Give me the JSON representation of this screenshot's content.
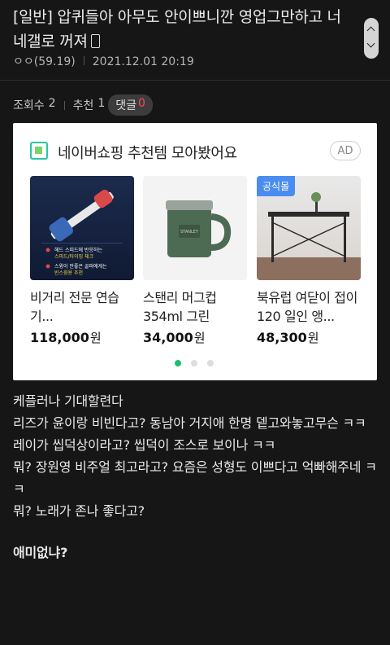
{
  "post": {
    "title": "[일반] 압퀴들아 아무도 안이쁘니깐 영업그만하고 너네갤로 꺼져",
    "author": "ㅇㅇ(59.19)",
    "datetime": "2021.12.01 20:19",
    "views_label": "조회수",
    "views": "2",
    "recommend_label": "추천",
    "recommend": "1",
    "comments_label": "댓글",
    "comments": "0"
  },
  "ad": {
    "header": "네이버쇼핑 추천템 모아봤어요",
    "badge": "AD",
    "official_badge": "공식몰",
    "products": [
      {
        "name": "비거리 전문 연습기...",
        "price": "118,000",
        "unit": "원",
        "img_text1": "헤드 스피드에 반응하는",
        "img_text2": "스피드/타이밍 체크",
        "img_text3": "스윙이 안좋은 골퍼에게는",
        "img_text4": "빈스윙용 추천"
      },
      {
        "name": "스탠리 머그컵 354ml 그린",
        "price": "34,000",
        "unit": "원"
      },
      {
        "name": "북유럽 여닫이 접이 120 일인 앵...",
        "price": "48,300",
        "unit": "원"
      }
    ],
    "page_index": 1,
    "page_count": 3
  },
  "content": {
    "lines": [
      "케플러나 기대할련다",
      "리즈가 윤이랑 비빈다고? 동남아 거지애 한명 뎉고와놓고무슨 ㅋㅋ",
      "레이가 씹덕상이라고? 씹덕이 조스로 보이나 ㅋㅋ",
      "뭐? 장원영 비주얼 최고라고? 요즘은 성형도 이쁘다고 억빠해주네 ㅋㅋ",
      "뭐? 노래가 존나 좋다고?"
    ],
    "closing": "애미없냐?"
  },
  "colors": {
    "accent_comment": "#ff4a4a",
    "dot_active": "#1fbe6c",
    "naver_green": "#26c6a4"
  }
}
